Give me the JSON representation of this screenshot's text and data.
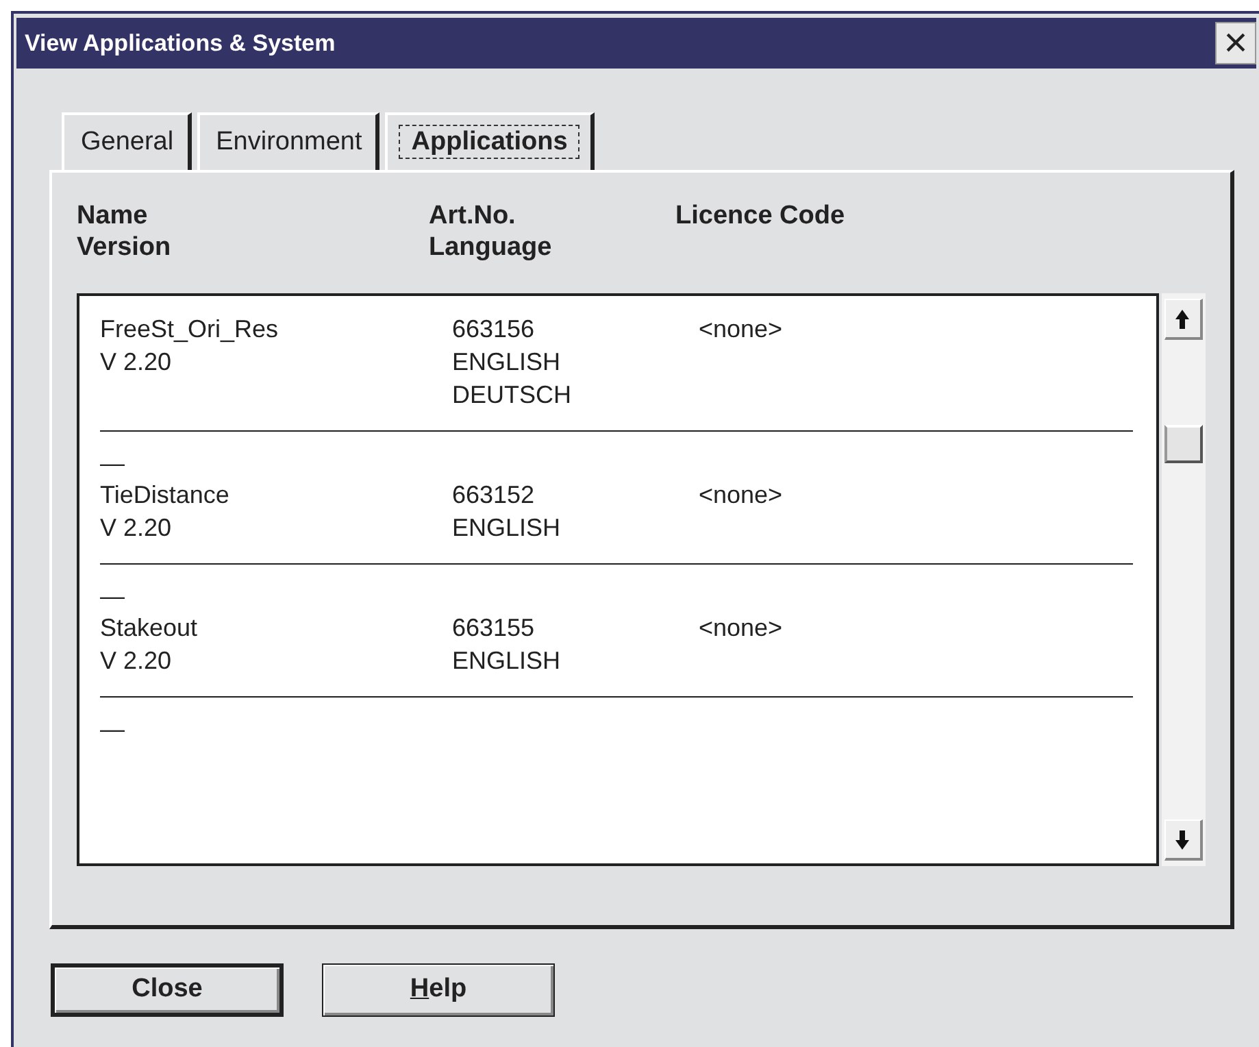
{
  "window": {
    "title": "View Applications & System",
    "close_glyph": "×"
  },
  "tabs": [
    {
      "label": "General",
      "selected": false
    },
    {
      "label": "Environment",
      "selected": false
    },
    {
      "label": "Applications",
      "selected": true
    }
  ],
  "headers": [
    {
      "line1": "Name",
      "line2": "Version"
    },
    {
      "line1": "Art.No.",
      "line2": "Language"
    },
    {
      "line1": "Licence Code"
    }
  ],
  "entries": [
    {
      "kind": "app",
      "name": "FreeSt_Ori_Res",
      "version": "V 2.20",
      "art_no": "663156",
      "languages": [
        "ENGLISH",
        "DEUTSCH"
      ],
      "licence": "<none>"
    },
    {
      "kind": "dash",
      "text": "—"
    },
    {
      "kind": "app",
      "name": "TieDistance",
      "version": "V 2.20",
      "art_no": "663152",
      "languages": [
        "ENGLISH"
      ],
      "licence": "<none>"
    },
    {
      "kind": "dash",
      "text": "—"
    },
    {
      "kind": "app",
      "name": "Stakeout",
      "version": "V 2.20",
      "art_no": "663155",
      "languages": [
        "ENGLISH"
      ],
      "licence": "<none>"
    },
    {
      "kind": "dash",
      "text": "—"
    }
  ],
  "buttons": [
    {
      "label": "Close",
      "default": true,
      "underline_first": false
    },
    {
      "label": "Help",
      "default": false,
      "underline_first": true
    }
  ]
}
